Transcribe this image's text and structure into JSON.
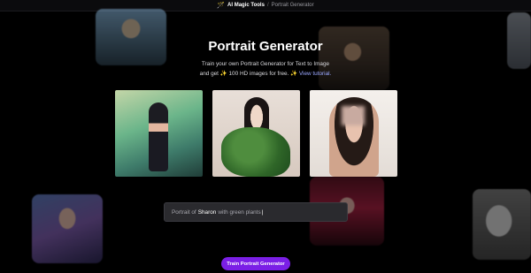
{
  "topbar": {
    "icon": "magic-wand-icon",
    "brand": "AI Magic Tools",
    "separator": "/",
    "current": "Portrait Generator"
  },
  "hero": {
    "title": "Portrait Generator",
    "subtitle_line1": "Train your own Portrait Generator for Text to Image",
    "subtitle_line2_prefix": "and get",
    "sparkle": "✨",
    "subtitle_line2_mid": "100 HD images for free.",
    "sparkle2": "✨",
    "tutorial_link": "View tutorial."
  },
  "gallery": {
    "images": [
      "portrait-woman-tropical",
      "portrait-woman-green-plant",
      "portrait-woman-photo"
    ]
  },
  "prompt": {
    "prefix": "Portrait of",
    "name": "Sharon",
    "suffix": "with green plants",
    "caret": "|"
  },
  "cta": {
    "label": "Train Portrait Generator"
  },
  "colors": {
    "accent": "#7b1fe6",
    "background": "#000000",
    "link": "#9aa7ff"
  }
}
